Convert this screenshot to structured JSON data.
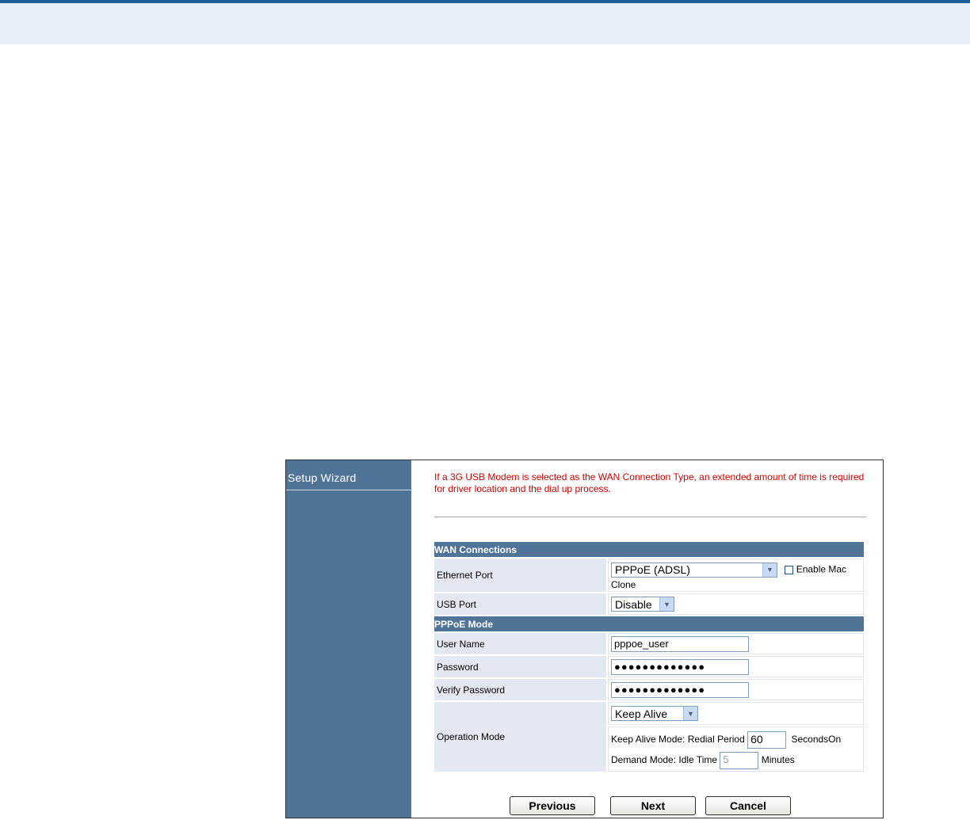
{
  "sidebar": {
    "title": "Setup Wizard"
  },
  "notice": "If a 3G USB Modem is selected as the WAN Connection Type, an extended amount of time is required for driver location and the dial up process.",
  "wan": {
    "heading": "WAN Connections",
    "ethernet_label": "Ethernet Port",
    "ethernet_value": "PPPoE (ADSL)",
    "enable_mac_label": "Enable Mac",
    "clone_label": "Clone",
    "usb_label": "USB Port",
    "usb_value": "Disable"
  },
  "pppoe": {
    "heading": "PPPoE Mode",
    "username_label": "User Name",
    "username_value": "pppoe_user",
    "password_label": "Password",
    "password_value": "●●●●●●●●●●●●●",
    "verify_label": "Verify Password",
    "verify_value": "●●●●●●●●●●●●●",
    "opmode_label": "Operation Mode",
    "opmode_value": "Keep Alive",
    "keepalive_label": "Keep Alive Mode: Redial Period",
    "keepalive_value": "60",
    "keepalive_unit": "SecondsOn",
    "demand_label": "Demand Mode: Idle Time",
    "demand_value": "5",
    "demand_unit": "Minutes"
  },
  "buttons": {
    "previous": "Previous",
    "next": "Next",
    "cancel": "Cancel"
  }
}
